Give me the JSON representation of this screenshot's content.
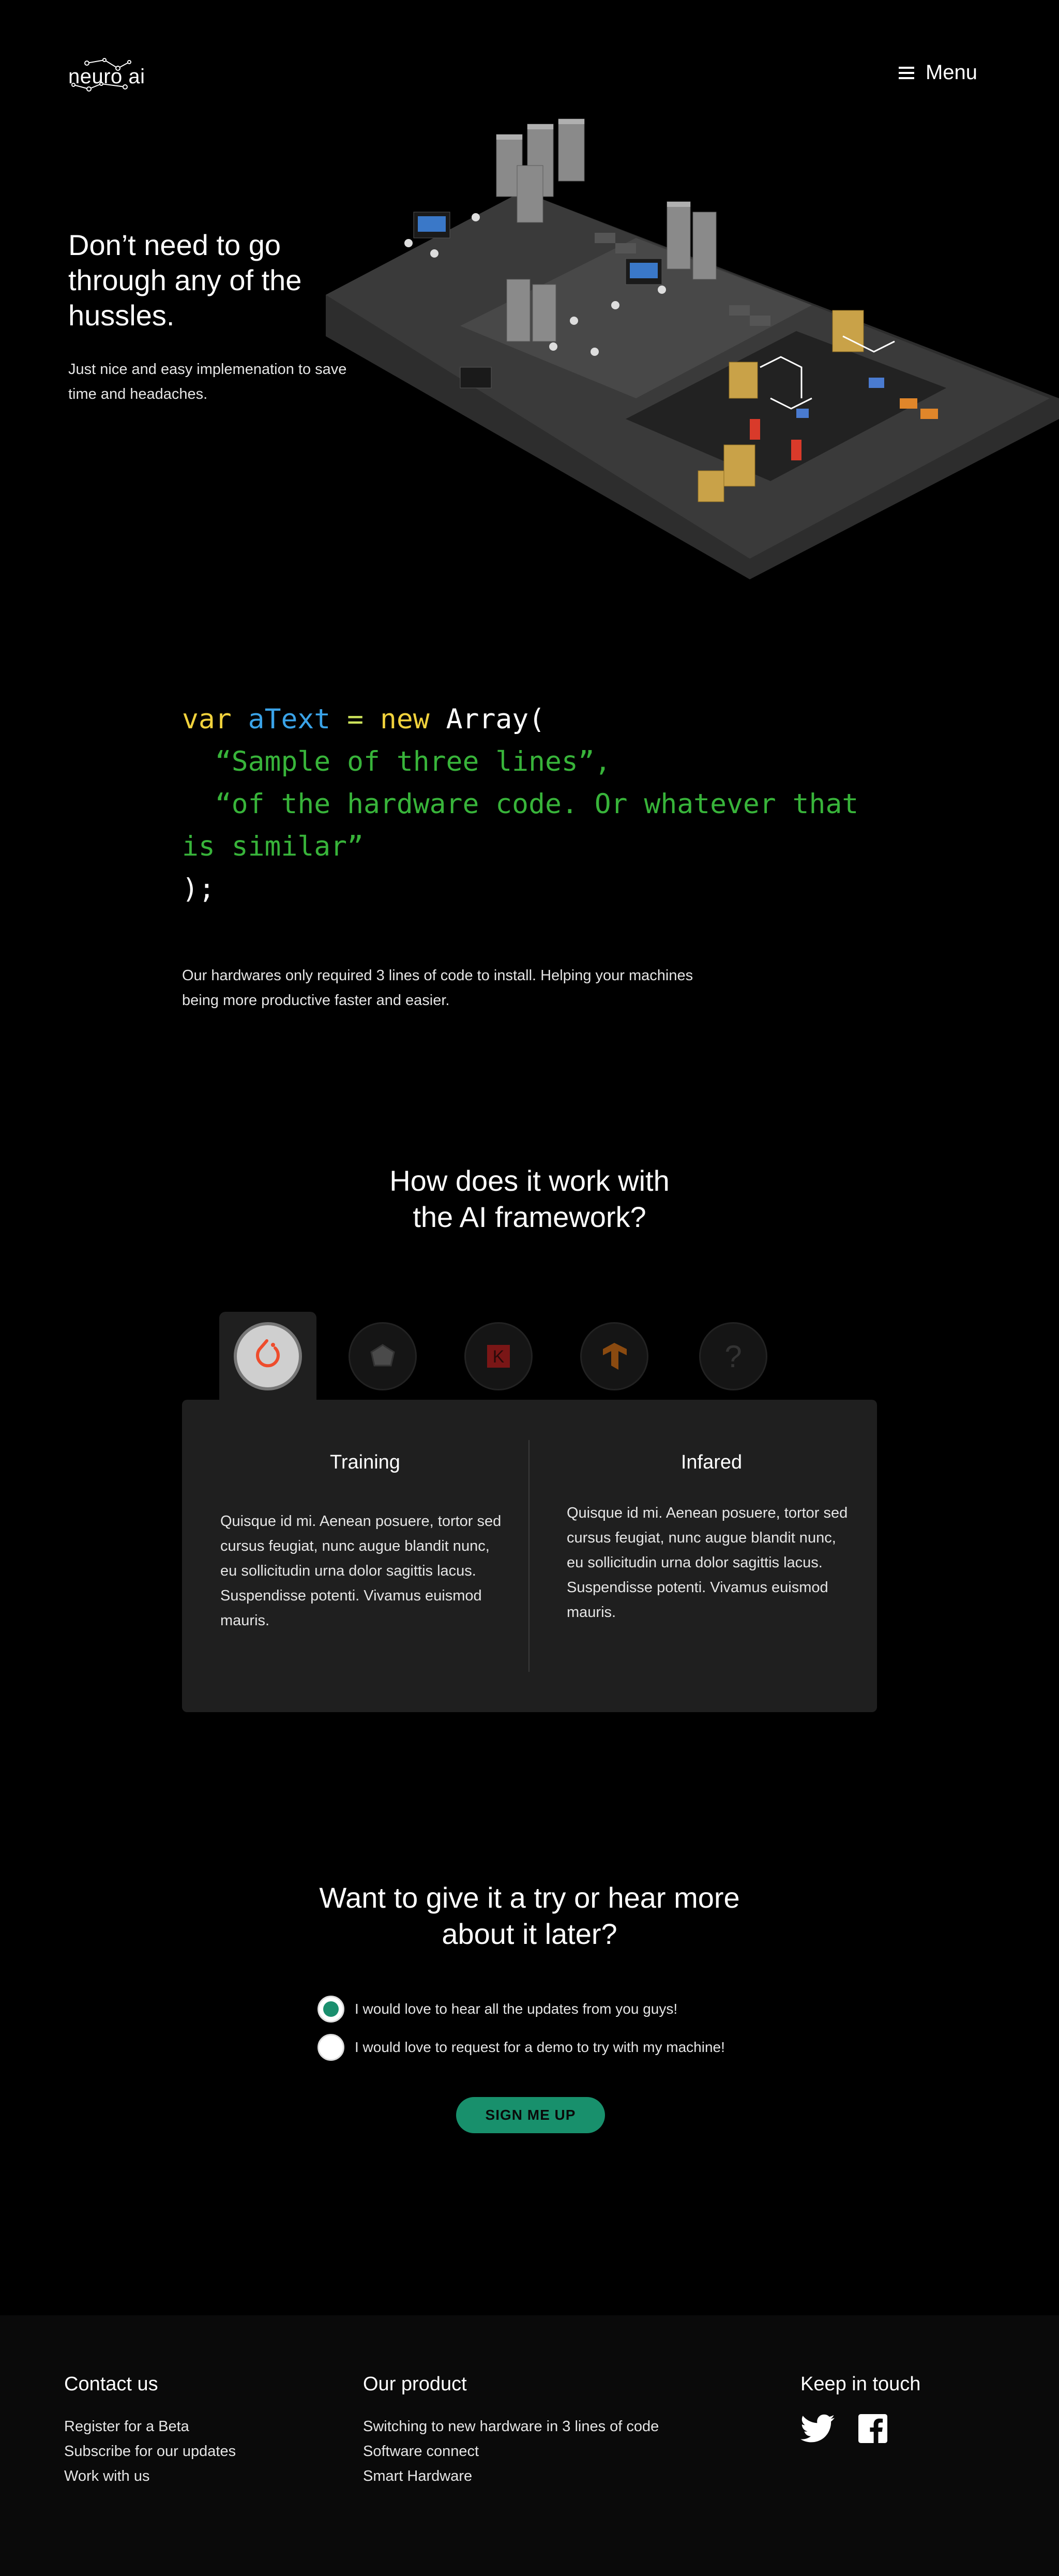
{
  "header": {
    "logo_text": "neuro ai",
    "menu_label": "Menu"
  },
  "hero": {
    "title": "Don’t need to go through any of the hussles.",
    "subtitle": "Just nice and easy implemenation to save time and headaches."
  },
  "code": {
    "line1_kw": "var",
    "line1_var": "aText",
    "line1_op": "=",
    "line1_new": "new",
    "line1_cls": "Array(",
    "line2": "  “Sample of three lines”,",
    "line3": "  “of the hardware code. Or whatever that is similar”",
    "line4": ");",
    "description": "Our hardwares only required 3 lines of code to install. Helping your machines being more productive faster and easier."
  },
  "how": {
    "title_line1": "How does it work with",
    "title_line2": "the AI framework?",
    "tabs": [
      {
        "icon": "pytorch-icon",
        "active": true,
        "color": "#ee4c2c"
      },
      {
        "icon": "onnx-icon",
        "active": false,
        "color": "#444444"
      },
      {
        "icon": "keras-icon",
        "active": false,
        "color": "#8b1a1a",
        "glyph": "K"
      },
      {
        "icon": "tensorflow-icon",
        "active": false,
        "color": "#a35a10"
      },
      {
        "icon": "unknown-icon",
        "active": false,
        "color": "#333333",
        "glyph": "?"
      }
    ],
    "training": {
      "title": "Training",
      "body": "Quisque id mi. Aenean posuere, tortor sed cursus feugiat, nunc augue blandit nunc, eu sollicitudin urna dolor sagittis lacus. Suspendisse potenti. Vivamus euismod mauris."
    },
    "infared": {
      "title": "Infared",
      "body": "Quisque id mi. Aenean posuere, tortor sed cursus feugiat, nunc augue blandit nunc, eu sollicitudin urna dolor sagittis lacus. Suspendisse potenti. Vivamus euismod mauris."
    }
  },
  "signup": {
    "title_line1": "Want to give it a try or hear more",
    "title_line2": "about it later?",
    "options": [
      {
        "label": "I would love to hear all the updates from you guys!",
        "checked": true
      },
      {
        "label": "I would love to request for a demo to try with my machine!",
        "checked": false
      }
    ],
    "button_label": "SIGN ME UP",
    "accent_color": "#18906c"
  },
  "footer": {
    "contact": {
      "heading": "Contact us",
      "links": [
        "Register for a Beta",
        "Subscribe for our updates",
        "Work with us"
      ]
    },
    "product": {
      "heading": "Our product",
      "links": [
        "Switching to new hardware in 3 lines of code",
        "Software connect",
        "Smart Hardware"
      ]
    },
    "social": {
      "heading": "Keep in touch",
      "icons": [
        "twitter-icon",
        "facebook-icon"
      ]
    }
  }
}
